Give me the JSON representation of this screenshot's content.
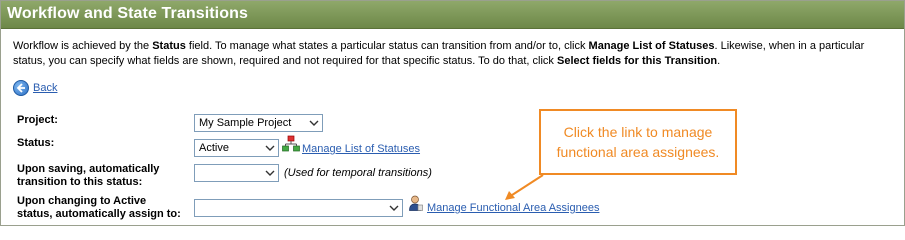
{
  "header": {
    "title": "Workflow and State Transitions"
  },
  "description": {
    "p1": "Workflow is achieved by the ",
    "b1": "Status",
    "p2": " field. To manage what states a particular status can transition from and/or to, click ",
    "b2": "Manage List of Statuses",
    "p3": ".  Likewise, when in a particular status, you can specify what fields are shown, required and not required for that specific status.  To do that, click ",
    "b3": "Select fields for this Transition",
    "p4": "."
  },
  "back": {
    "label": "Back",
    "icon": "back-arrow-icon"
  },
  "form": {
    "project": {
      "label": "Project:",
      "value": "My Sample Project"
    },
    "status": {
      "label": "Status:",
      "value": "Active",
      "link": "Manage List of Statuses",
      "icon": "workflow-icon"
    },
    "saving": {
      "label_line1": "Upon saving, automatically",
      "label_line2": "transition to this status:",
      "value": "",
      "note": "(Used for temporal transitions)"
    },
    "changing": {
      "label_line1": "Upon changing to Active",
      "label_line2": "status, automatically assign to:",
      "value": "",
      "link": "Manage Functional Area Assignees",
      "icon": "user-icon"
    }
  },
  "callout": {
    "text": "Click the link to manage functional area assignees."
  },
  "colors": {
    "header": "#7a9455",
    "link": "#2a5db0",
    "callout": "#f08a24"
  }
}
